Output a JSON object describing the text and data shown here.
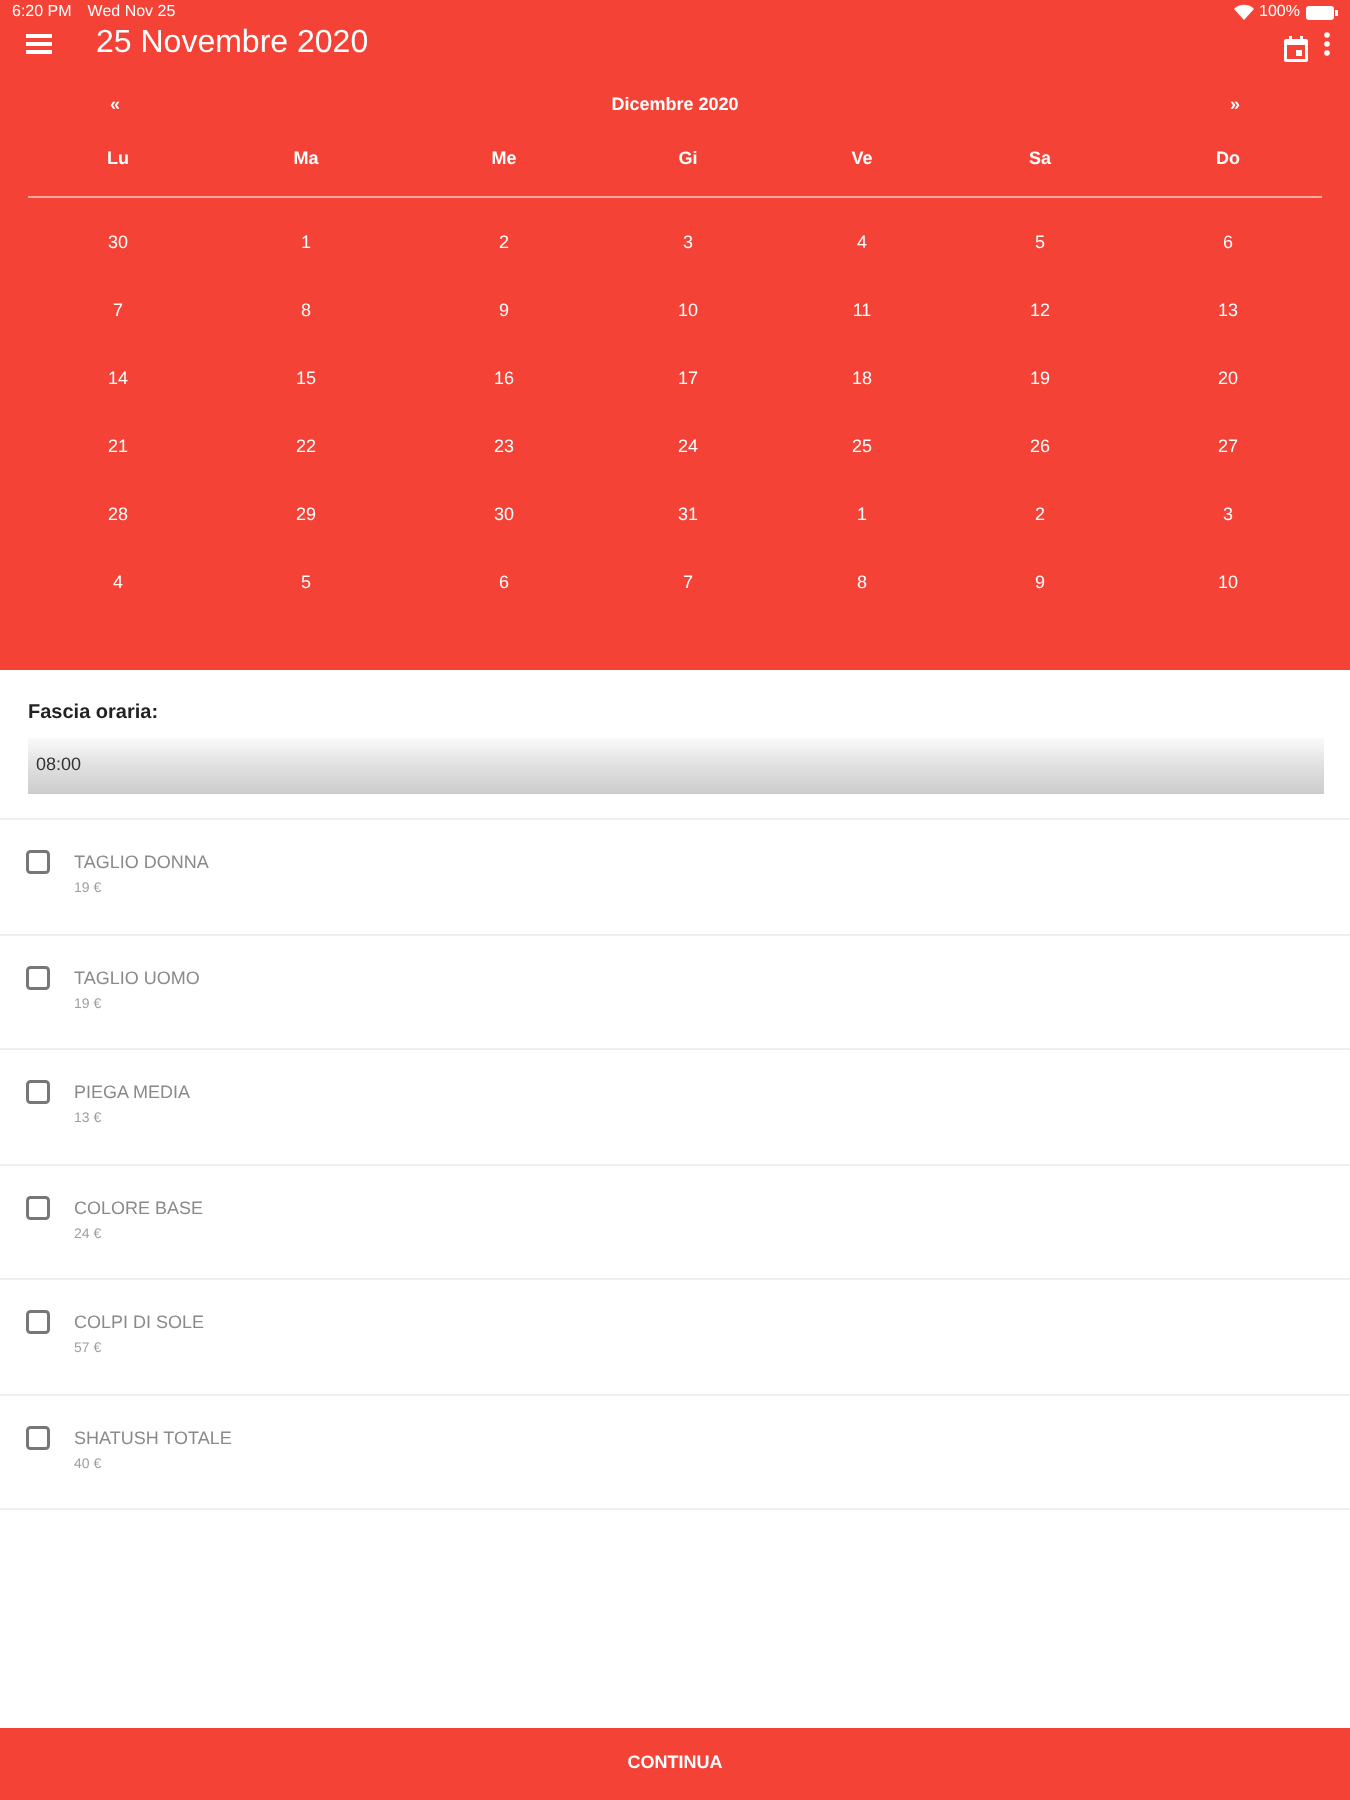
{
  "status_bar": {
    "time": "6:20 PM",
    "date": "Wed Nov 25",
    "battery": "100%"
  },
  "app_bar": {
    "title": "25 Novembre 2020"
  },
  "calendar": {
    "prev": "«",
    "month": "Dicembre 2020",
    "next": "»",
    "weekdays": [
      "Lu",
      "Ma",
      "Me",
      "Gi",
      "Ve",
      "Sa",
      "Do"
    ],
    "weeks": [
      [
        "30",
        "1",
        "2",
        "3",
        "4",
        "5",
        "6"
      ],
      [
        "7",
        "8",
        "9",
        "10",
        "11",
        "12",
        "13"
      ],
      [
        "14",
        "15",
        "16",
        "17",
        "18",
        "19",
        "20"
      ],
      [
        "21",
        "22",
        "23",
        "24",
        "25",
        "26",
        "27"
      ],
      [
        "28",
        "29",
        "30",
        "31",
        "1",
        "2",
        "3"
      ],
      [
        "4",
        "5",
        "6",
        "7",
        "8",
        "9",
        "10"
      ]
    ]
  },
  "time_slot": {
    "label": "Fascia oraria:",
    "value": "08:00"
  },
  "services": [
    {
      "name": "TAGLIO DONNA",
      "price": "19 €",
      "checked": false
    },
    {
      "name": "TAGLIO UOMO",
      "price": "19 €",
      "checked": false
    },
    {
      "name": "PIEGA MEDIA",
      "price": "13 €",
      "checked": false
    },
    {
      "name": "COLORE BASE",
      "price": "24 €",
      "checked": false
    },
    {
      "name": "COLPI DI SOLE",
      "price": "57 €",
      "checked": false
    },
    {
      "name": "SHATUSH TOTALE",
      "price": "40 €",
      "checked": false
    }
  ],
  "continue_button": "CONTINUA"
}
